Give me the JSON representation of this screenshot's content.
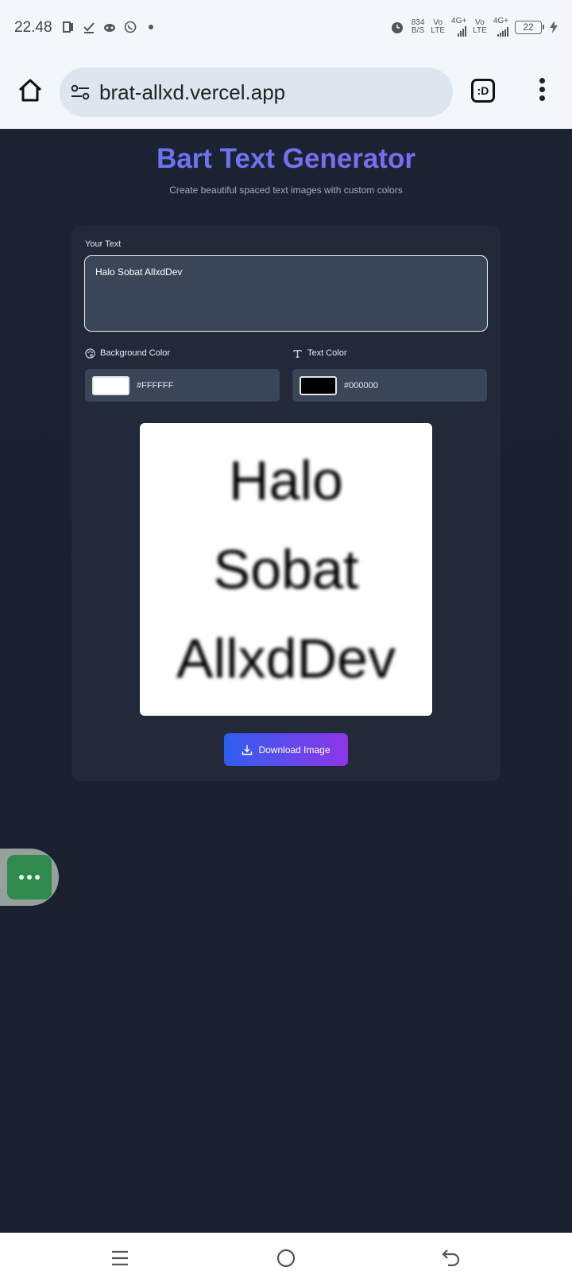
{
  "status_bar": {
    "time": "22.48",
    "net_speed_value": "834",
    "net_speed_unit": "B/S",
    "volte1_top": "Vo",
    "volte1_bottom": "LTE",
    "net1": "4G+",
    "volte2_top": "Vo",
    "volte2_bottom": "LTE",
    "net2": "4G+",
    "battery": "22"
  },
  "browser": {
    "url": "brat-allxd.vercel.app",
    "tabs_label": ":D"
  },
  "page": {
    "title": "Bart Text Generator",
    "subtitle": "Create beautiful spaced text images with custom colors"
  },
  "form": {
    "text_label": "Your Text",
    "text_value": "Halo Sobat AllxdDev",
    "bg_label": "Background Color",
    "bg_value": "#FFFFFF",
    "bg_swatch": "#ffffff",
    "text_color_label": "Text Color",
    "text_color_value": "#000000",
    "text_swatch": "#000000"
  },
  "preview": {
    "words": [
      "Halo",
      "Sobat",
      "AllxdDev"
    ]
  },
  "actions": {
    "download_label": "Download Image"
  },
  "colors": {
    "accent_start": "#2f5ff0",
    "accent_end": "#8e35e8",
    "page_bg": "#1a2030",
    "card_bg": "#222a3a"
  }
}
